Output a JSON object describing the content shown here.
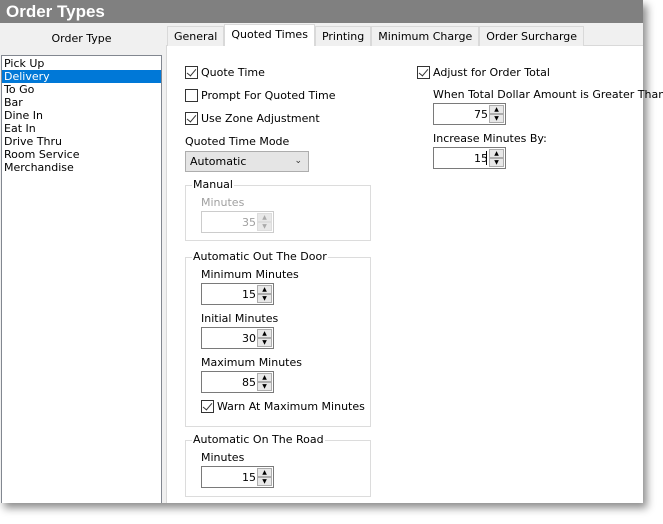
{
  "window": {
    "title": "Order Types"
  },
  "order_types": {
    "header": "Order Type",
    "items": [
      "Pick Up",
      "Delivery",
      "To Go",
      "Bar",
      "Dine In",
      "Eat In",
      "Drive Thru",
      "Room Service",
      "Merchandise"
    ],
    "selected": "Delivery"
  },
  "tabs": [
    {
      "label": "General"
    },
    {
      "label": "Quoted Times",
      "active": true
    },
    {
      "label": "Printing"
    },
    {
      "label": "Minimum Charge"
    },
    {
      "label": "Order Surcharge"
    }
  ],
  "quoted": {
    "quote_time": {
      "label": "Quote Time",
      "checked": true
    },
    "prompt": {
      "label": "Prompt For Quoted Time",
      "checked": false
    },
    "zone": {
      "label": "Use Zone Adjustment",
      "checked": true
    },
    "mode_label": "Quoted Time Mode",
    "mode_value": "Automatic",
    "manual": {
      "legend": "Manual",
      "minutes_label": "Minutes",
      "minutes": "35"
    },
    "otd": {
      "legend": "Automatic Out The Door",
      "min_label": "Minimum Minutes",
      "min": "15",
      "init_label": "Initial Minutes",
      "init": "30",
      "max_label": "Maximum Minutes",
      "max": "85",
      "warn": {
        "label": "Warn At Maximum Minutes",
        "checked": true
      }
    },
    "road": {
      "legend": "Automatic On The Road",
      "minutes_label": "Minutes",
      "minutes": "15"
    },
    "adjust": {
      "label": "Adjust for Order Total",
      "checked": true
    },
    "dollar_label": "When Total Dollar Amount is Greater Than:",
    "dollar": "75",
    "increase_label": "Increase Minutes By:",
    "increase": "15"
  },
  "colors": {
    "title_bar": "#808080",
    "selection": "#0078d7"
  }
}
